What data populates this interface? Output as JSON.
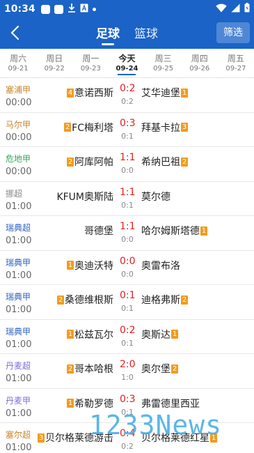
{
  "status": {
    "time": "10:34"
  },
  "nav": {
    "tabs": [
      "足球",
      "篮球"
    ],
    "filter": "筛选"
  },
  "dates": [
    {
      "w": "周六",
      "d": "09-21"
    },
    {
      "w": "周日",
      "d": "09-22"
    },
    {
      "w": "周一",
      "d": "09-23"
    },
    {
      "w": "今天",
      "d": "09-24"
    },
    {
      "w": "周三",
      "d": "09-25"
    },
    {
      "w": "周四",
      "d": "09-26"
    },
    {
      "w": "周五",
      "d": "09-27"
    }
  ],
  "matches": [
    {
      "league": "塞浦甲",
      "league_color": "#c7842f",
      "time": "00:00",
      "home": "意诺西斯",
      "home_rank": "4",
      "away": "艾华迪堡",
      "away_rank": "1",
      "score": "0:2",
      "half": "0:2"
    },
    {
      "league": "马尔甲",
      "league_color": "#c7842f",
      "time": "00:00",
      "home": "FC梅利塔",
      "home_rank": "2",
      "away": "拜基卡拉",
      "away_rank": "3",
      "score": "0:3",
      "half": "0:1"
    },
    {
      "league": "危地甲",
      "league_color": "#36a35a",
      "time": "00:00",
      "home": "阿库阿帕",
      "home_rank": "2",
      "away": "希纳巴祖",
      "away_rank": "2",
      "score": "1:1",
      "half": "0:0"
    },
    {
      "league": "挪超",
      "league_color": "#888888",
      "time": "01:00",
      "home": "KFUM奥斯陆",
      "home_rank": "",
      "away": "莫尔德",
      "away_rank": "",
      "score": "1:1",
      "half": "0:1"
    },
    {
      "league": "瑞典超",
      "league_color": "#2b62c0",
      "time": "01:00",
      "home": "哥德堡",
      "home_rank": "",
      "away": "哈尔姆斯塔德",
      "away_rank": "1",
      "score": "1:1",
      "half": "0:0"
    },
    {
      "league": "瑞典甲",
      "league_color": "#2b62c0",
      "time": "01:00",
      "home": "奥迪沃特",
      "home_rank": "1",
      "away": "奥雷布洛",
      "away_rank": "",
      "score": "0:0",
      "half": "0:0"
    },
    {
      "league": "瑞典甲",
      "league_color": "#2b62c0",
      "time": "01:00",
      "home": "桑德维根斯",
      "home_rank": "2",
      "away": "迪格弗斯",
      "away_rank": "2",
      "score": "0:1",
      "half": "0:1"
    },
    {
      "league": "瑞典甲",
      "league_color": "#2b62c0",
      "time": "01:00",
      "home": "松兹瓦尔",
      "home_rank": "1",
      "away": "奥斯达",
      "away_rank": "1",
      "score": "0:2",
      "half": "0:1"
    },
    {
      "league": "丹麦超",
      "league_color": "#7b6cd0",
      "time": "01:00",
      "home": "哥本哈根",
      "home_rank": "2",
      "away": "奥尔堡",
      "away_rank": "2",
      "score": "2:0",
      "half": "1:0"
    },
    {
      "league": "丹麦甲",
      "league_color": "#7b6cd0",
      "time": "01:00",
      "home": "希勒罗德",
      "home_rank": "1",
      "away": "弗雷德里西亚",
      "away_rank": "",
      "score": "0:3",
      "half": "0:1"
    },
    {
      "league": "塞尔超",
      "league_color": "#c7842f",
      "time": "01:00",
      "home": "贝尔格莱德游击",
      "home_rank": "3",
      "away": "贝尔格莱德红星",
      "away_rank": "1",
      "score": "0:4",
      "half": "0:2"
    }
  ],
  "watermark": "1233News",
  "colors": {
    "brand": "#1b63c6",
    "score": "#e01f1f",
    "rank_badge": "#f29b1d"
  }
}
